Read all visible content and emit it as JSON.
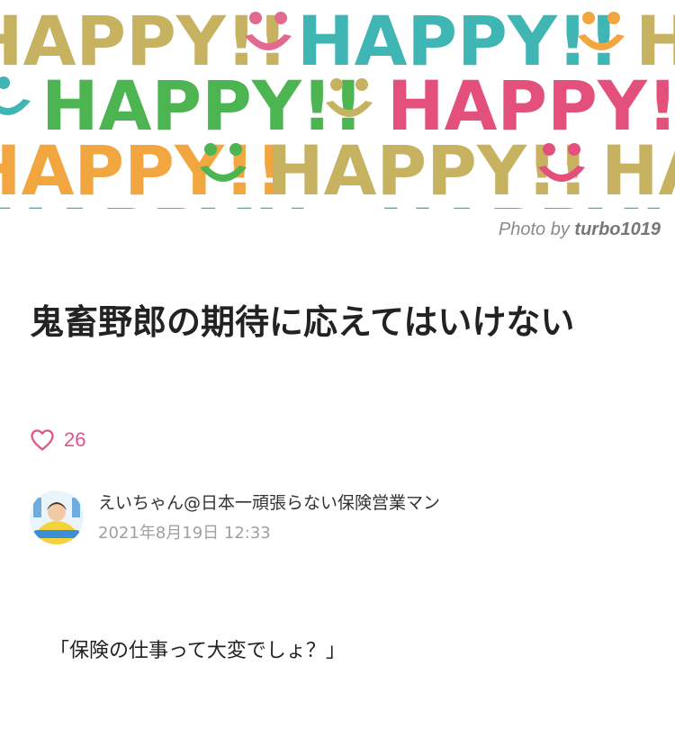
{
  "hero": {
    "banner_text": "HAPPY!!",
    "colors": {
      "olive": "#c6b260",
      "teal": "#3fb6b4",
      "green": "#4cb450",
      "pink": "#e4507c",
      "orange": "#f1a640",
      "smile_pink": "#e36a8e"
    }
  },
  "credit": {
    "prefix": "Photo by ",
    "author": "turbo1019"
  },
  "article": {
    "title": "鬼畜野郎の期待に応えてはいけない",
    "likes": "26",
    "author_name": "えいちゃん@日本一頑張らない保険営業マン",
    "date": "2021年8月19日 12:33",
    "first_line": "「保険の仕事って大変でしょ？」"
  },
  "icons": {
    "like": "heart-outline-icon"
  },
  "accent": "#e3528a"
}
